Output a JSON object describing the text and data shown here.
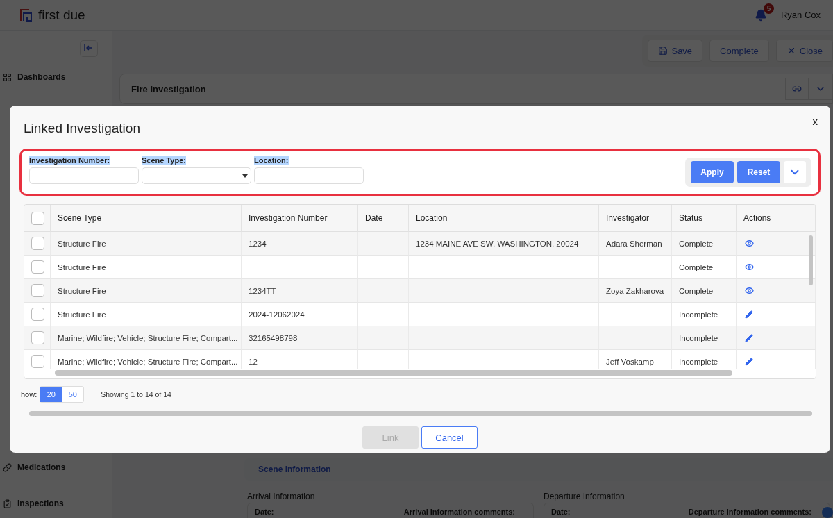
{
  "app": {
    "logo": "first due",
    "notifications": "5",
    "user": "Ryan Cox"
  },
  "sidebar": {
    "items": [
      {
        "label": "Dashboards",
        "kind": "dashboard"
      },
      {
        "label": "Medications",
        "kind": "medication"
      },
      {
        "label": "Inspections",
        "kind": "inspection"
      }
    ]
  },
  "toolbar": {
    "buttons": [
      {
        "label": "Save",
        "kind": "save"
      },
      {
        "label": "Complete",
        "kind": "plain"
      },
      {
        "label": "Close",
        "kind": "close"
      }
    ]
  },
  "section": {
    "title": "Fire Investigation"
  },
  "scene_information": {
    "title": "Scene Information",
    "groups": [
      {
        "title": "Arrival Information",
        "fields": [
          "Date:",
          "Arrival information comments:"
        ]
      },
      {
        "title": "Departure Information",
        "fields": [
          "Date:",
          "Departure information comments:"
        ]
      }
    ]
  },
  "dialog": {
    "title": "Linked Investigation",
    "close": "x",
    "filters": [
      {
        "label": "Investigation Number:",
        "kind": "text"
      },
      {
        "label": "Scene Type:",
        "kind": "select"
      },
      {
        "label": "Location:",
        "kind": "text"
      }
    ],
    "filter_buttons": [
      "Apply",
      "Reset"
    ],
    "table": {
      "all_selected": false,
      "columns": [
        "Scene Type",
        "Investigation Number",
        "Date",
        "Location",
        "Investigator",
        "Status",
        "Actions"
      ],
      "rows": [
        {
          "selected": false,
          "cells": [
            "Structure Fire",
            "1234",
            "",
            "1234 MAINE AVE SW, WASHINGTON, 20024",
            "Adara Sherman",
            "Complete"
          ],
          "kind": "view"
        },
        {
          "selected": false,
          "cells": [
            "Structure Fire",
            "",
            "",
            "",
            "",
            "Complete"
          ],
          "kind": "view"
        },
        {
          "selected": false,
          "cells": [
            "Structure Fire",
            "1234TT",
            "",
            "",
            "Zoya Zakharova",
            "Complete"
          ],
          "kind": "view"
        },
        {
          "selected": false,
          "cells": [
            "Structure Fire",
            "2024-12062024",
            "",
            "",
            "",
            "Incomplete"
          ],
          "kind": "edit"
        },
        {
          "selected": false,
          "cells": [
            "Marine; Wildfire; Vehicle; Structure Fire; Compart...",
            "32165498798",
            "",
            "",
            "",
            "Incomplete"
          ],
          "kind": "edit"
        },
        {
          "selected": false,
          "cells": [
            "Marine; Wildfire; Vehicle; Structure Fire; Compart...",
            "12",
            "",
            "",
            "Jeff Voskamp",
            "Incomplete"
          ],
          "kind": "edit"
        }
      ]
    },
    "pagination": {
      "label": "how:",
      "sizes": [
        {
          "label": "20",
          "selected": true
        },
        {
          "label": "50",
          "selected": false
        }
      ],
      "summary": "Showing 1 to 14 of 14"
    },
    "buttons": [
      {
        "label": "Link",
        "kind": "primary",
        "disabled": true
      },
      {
        "label": "Cancel",
        "kind": "outline",
        "disabled": false
      }
    ]
  }
}
